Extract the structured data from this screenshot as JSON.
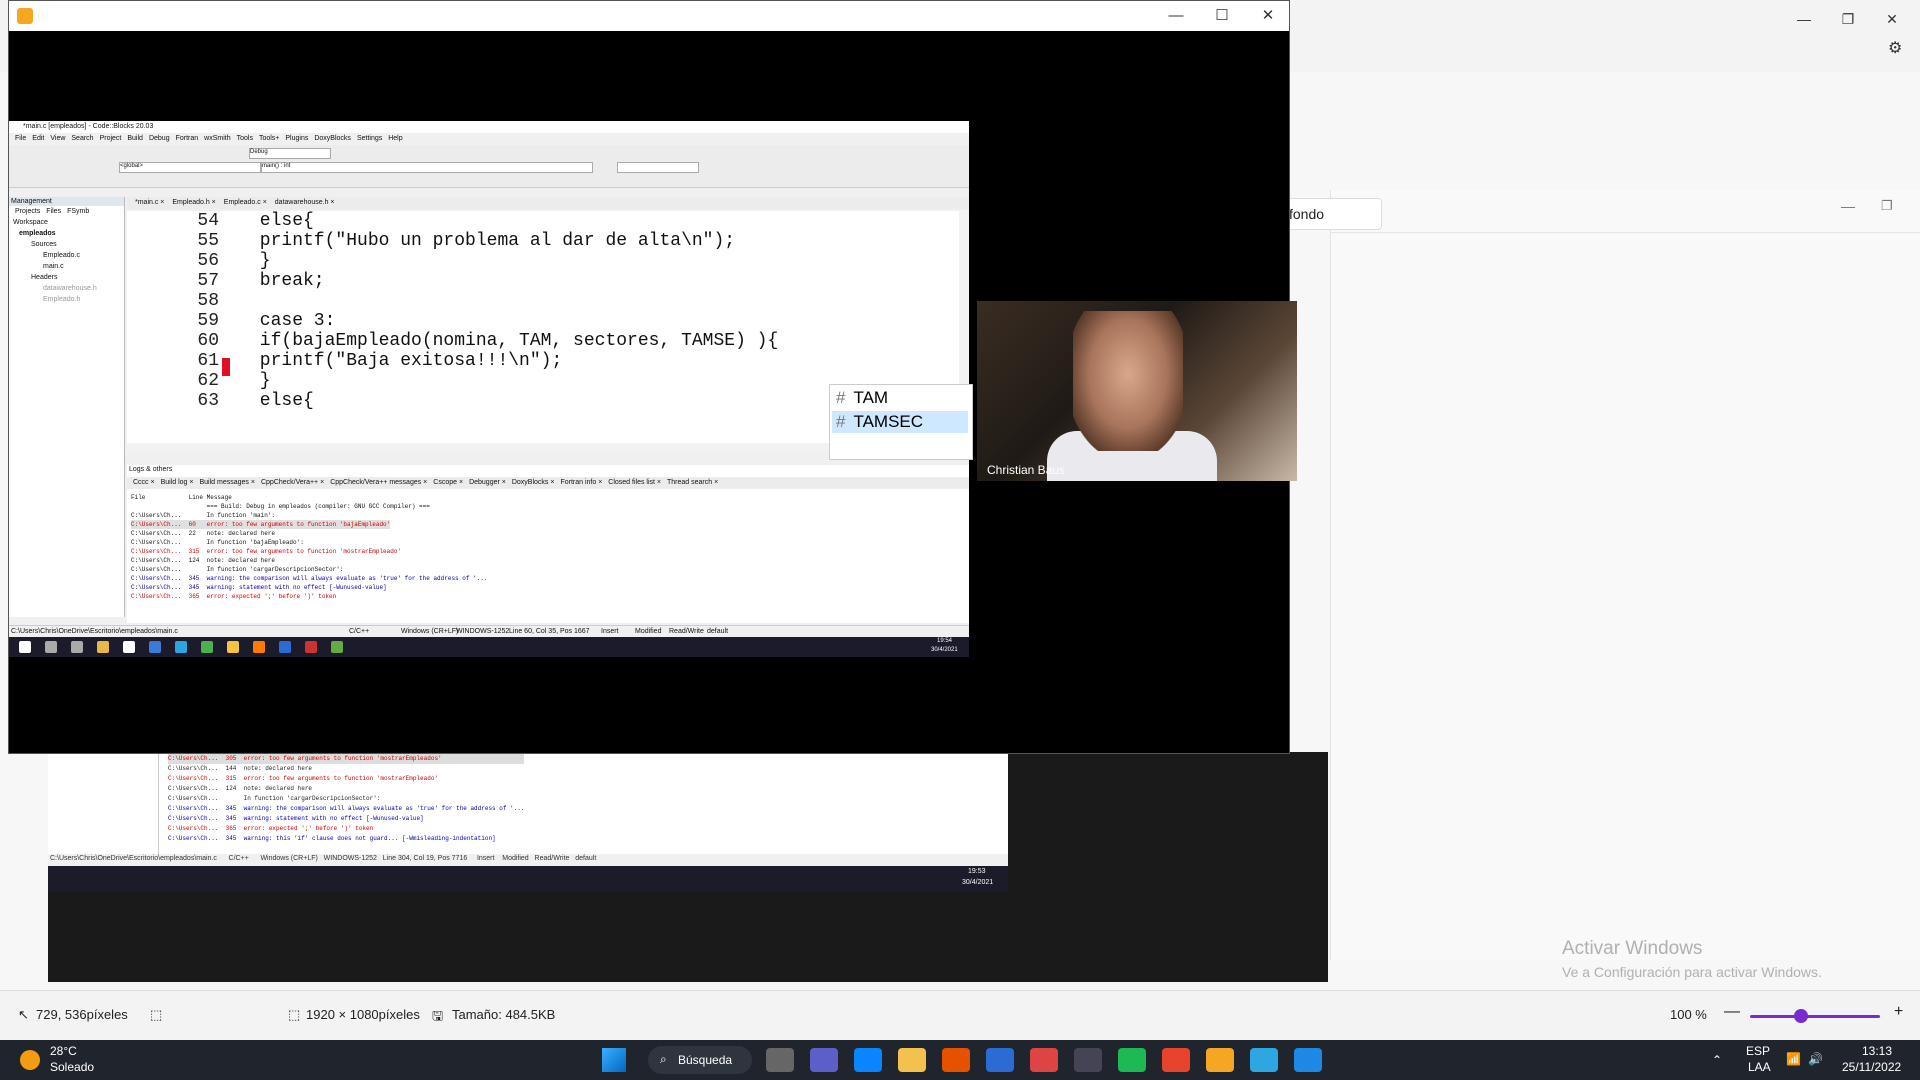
{
  "paint": {
    "status": {
      "cursor_pos": "729, 536píxeles",
      "dimensions": "1920 × 1080píxeles",
      "size": "Tamaño: 484.5KB",
      "zoom": "100 %"
    },
    "chip_text": "fondo"
  },
  "player": {
    "participant_name": "Christian Baus"
  },
  "codeblocks": {
    "title": "*main.c [empleados] - Code::Blocks 20.03",
    "menu": [
      "File",
      "Edit",
      "View",
      "Search",
      "Project",
      "Build",
      "Debug",
      "Fortran",
      "wxSmith",
      "Tools",
      "Tools+",
      "Plugins",
      "DoxyBlocks",
      "Settings",
      "Help"
    ],
    "build_target": "Debug",
    "scope": "<global>",
    "function": "main() : int",
    "management_title": "Management",
    "mgmt_tabs": [
      "Projects",
      "Files",
      "FSymb"
    ],
    "tree": [
      "Workspace",
      "empleados",
      "Sources",
      "Empleado.c",
      "main.c",
      "Headers",
      "datawarehouse.h",
      "Empleado.h"
    ],
    "editor_tabs": [
      "*main.c",
      "Empleado.h",
      "Empleado.c",
      "datawarehouse.h"
    ],
    "code": [
      {
        "n": "54",
        "t": "        else{"
      },
      {
        "n": "55",
        "t": "          printf(\"Hubo un problema al dar de alta\\n\");"
      },
      {
        "n": "56",
        "t": "        }"
      },
      {
        "n": "57",
        "t": "          break;"
      },
      {
        "n": "58",
        "t": ""
      },
      {
        "n": "59",
        "t": "      case 3:"
      },
      {
        "n": "60",
        "t": "        if(bajaEmpleado(nomina, TAM, sectores, TAMSE) ){"
      },
      {
        "n": "61",
        "t": "          printf(\"Baja exitosa!!!\\n\");"
      },
      {
        "n": "62",
        "t": "        }"
      },
      {
        "n": "63",
        "t": "        else{"
      }
    ],
    "autocomplete": [
      "TAM",
      "TAMSEC"
    ],
    "logs_title": "Logs & others",
    "log_tabs": [
      "Cccc",
      "Build log",
      "Build messages",
      "CppCheck/Vera++",
      "CppCheck/Vera++ messages",
      "Cscope",
      "Debugger",
      "DoxyBlocks",
      "Fortran info",
      "Closed files list",
      "Thread search"
    ],
    "log_header": [
      "File",
      "Line",
      "Message"
    ],
    "log_rows": [
      {
        "file": "",
        "line": "",
        "msg": "=== Build: Debug in empleados (compiler: GNU GCC Compiler) ==="
      },
      {
        "file": "C:\\Users\\Ch...",
        "line": "",
        "msg": "In function 'main':"
      },
      {
        "file": "C:\\Users\\Ch...",
        "line": "60",
        "msg": "error: too few arguments to function 'bajaEmpleado'"
      },
      {
        "file": "C:\\Users\\Ch...",
        "line": "22",
        "msg": "note: declared here"
      },
      {
        "file": "C:\\Users\\Ch...",
        "line": "",
        "msg": "In function 'bajaEmpleado':"
      },
      {
        "file": "C:\\Users\\Ch...",
        "line": "315",
        "msg": "error: too few arguments to function 'mostrarEmpleado'"
      },
      {
        "file": "C:\\Users\\Ch...",
        "line": "124",
        "msg": "note: declared here"
      },
      {
        "file": "C:\\Users\\Ch...",
        "line": "",
        "msg": "In function 'cargarDescripcionSector':"
      },
      {
        "file": "C:\\Users\\Ch...",
        "line": "345",
        "msg": "warning: the comparison will always evaluate as 'true' for the address of '..."
      },
      {
        "file": "C:\\Users\\Ch...",
        "line": "345",
        "msg": "warning: statement with no effect [-Wunused-value]"
      },
      {
        "file": "C:\\Users\\Ch...",
        "line": "365",
        "msg": "error: expected ';' before ')' token"
      }
    ],
    "status": {
      "path": "C:\\Users\\Chris\\OneDrive\\Escritorio\\empleados\\main.c",
      "lang": "C/C++",
      "eol": "Windows (CR+LF)",
      "enc": "WINDOWS-1252",
      "pos": "Line 60, Col 35, Pos 1667",
      "mode": "Insert",
      "mod": "Modified",
      "rw": "Read/Write",
      "def": "default"
    },
    "clock_time": "19:54",
    "clock_date": "30/4/2021"
  },
  "background_ide": {
    "log_rows": [
      "C:\\Users\\Ch...  305  error: too few arguments to function 'mostrarEmpleados'",
      "C:\\Users\\Ch...  144  note: declared here",
      "C:\\Users\\Ch...  315  error: too few arguments to function 'mostrarEmpleado'",
      "C:\\Users\\Ch...  124  note: declared here",
      "C:\\Users\\Ch...       In function 'cargarDescripcionSector':",
      "C:\\Users\\Ch...  345  warning: the comparison will always evaluate as 'true' for the address of '...",
      "C:\\Users\\Ch...  345  warning: statement with no effect [-Wunused-value]",
      "C:\\Users\\Ch...  365  error: expected ';' before ')' token",
      "C:\\Users\\Ch...  345  warning: this 'if' clause does not guard... [-Wmisleading-indentation]"
    ],
    "status": "C:\\Users\\Chris\\OneDrive\\Escritorio\\empleados\\main.c      C/C++      Windows (CR+LF)   WINDOWS-1252   Line 304, Col 19, Pos 7716     Insert    Modified   Read/Write   default",
    "clock_time": "19:53",
    "clock_date": "30/4/2021"
  },
  "watermark": {
    "title": "Activar Windows",
    "subtitle": "Ve a Configuración para activar Windows."
  },
  "taskbar": {
    "weather_temp": "28°C",
    "weather_desc": "Soleado",
    "search": "Búsqueda",
    "lang": "ESP",
    "lang2": "LAA",
    "time": "13:13",
    "date": "25/11/2022"
  },
  "colors": {
    "accent": "#7a2bd0",
    "taskbar": "#20252d",
    "error_marker": "#dd1122"
  }
}
